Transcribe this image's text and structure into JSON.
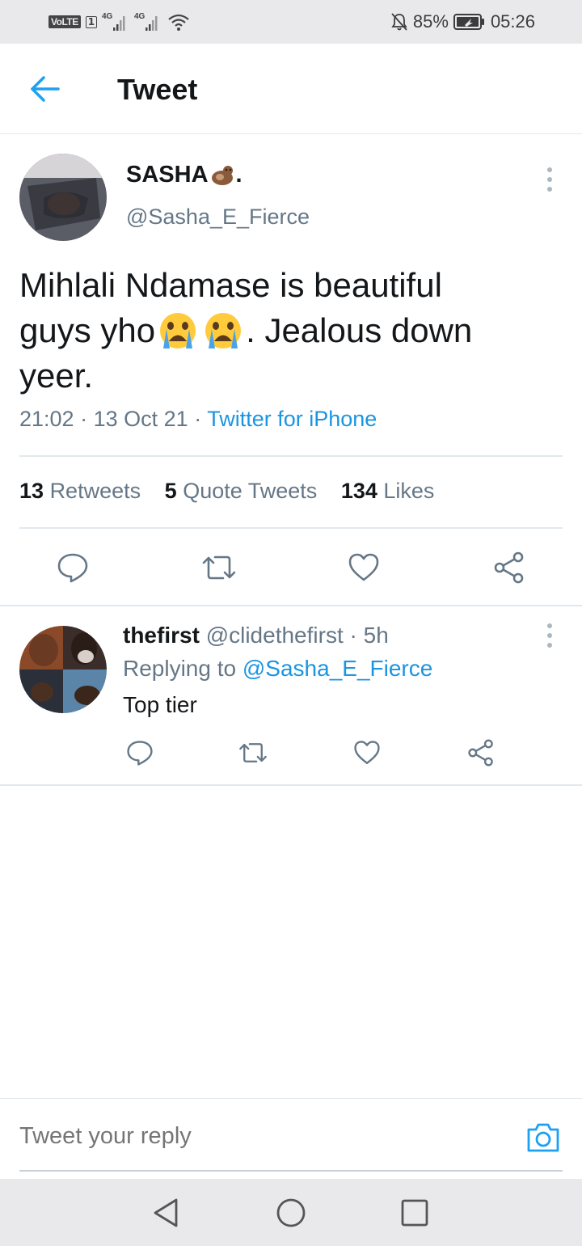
{
  "status_bar": {
    "volte": "VoLTE",
    "sim": "1",
    "net1": "4G",
    "net2": "4G",
    "battery": "85%",
    "time": "05:26"
  },
  "header": {
    "title": "Tweet"
  },
  "tweet": {
    "display_name": "SASHA",
    "name_suffix": ".",
    "handle": "@Sasha_E_Fierce",
    "text_line1": "Mihlali Ndamase is beautiful",
    "text_line2_a": "guys yho",
    "emoji": "😭",
    "text_line2_b": ". Jealous down",
    "text_line3": "yeer.",
    "time": "21:02",
    "date": "13 Oct 21",
    "source": "Twitter for iPhone",
    "stats": {
      "retweets_count": "13",
      "retweets_label": "Retweets",
      "quotes_count": "5",
      "quotes_label": "Quote Tweets",
      "likes_count": "134",
      "likes_label": "Likes"
    }
  },
  "reply": {
    "display_name": "thefirst",
    "handle": "@clidethefirst",
    "age": "5h",
    "replying_prefix": "Replying to",
    "replying_to": "@Sasha_E_Fierce",
    "text": "Top tier"
  },
  "compose": {
    "placeholder": "Tweet your reply"
  },
  "colors": {
    "accent": "#1b95e0",
    "secondary_text": "#657786",
    "divider": "#e1e8ed",
    "system_bar": "#e9e9ec"
  }
}
